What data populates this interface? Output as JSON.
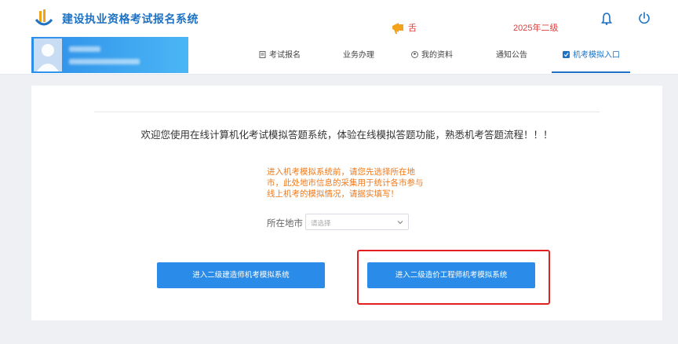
{
  "header": {
    "site_title": "建设执业资格考试报名系统",
    "notice_text": "舌",
    "year_level": "2025年二级"
  },
  "nav": {
    "items": [
      {
        "label": "考试报名",
        "icon": "document-icon"
      },
      {
        "label": "业务办理",
        "icon": ""
      },
      {
        "label": "我的资料",
        "icon": "user-icon"
      },
      {
        "label": "通知公告",
        "icon": ""
      },
      {
        "label": "机考模拟入口",
        "icon": "checkbox-icon",
        "active": true
      }
    ]
  },
  "main": {
    "welcome": "欢迎您使用在线计算机化考试模拟答题系统，体验在线模拟答题功能，熟悉机考答题流程！！！",
    "warning": "进入机考模拟系统前，请您先选择所在地市，此处地市信息的采集用于统计各市参与线上机考的模拟情况，请据实填写！",
    "city_label": "所在地市",
    "city_placeholder": "请选择",
    "button_a": "进入二级建造师机考模拟系统",
    "button_b": "进入二级造价工程师机考模拟系统"
  },
  "colors": {
    "brand": "#1d72c4",
    "button": "#2a8ce8",
    "warning": "#f07a1a",
    "highlight": "#e22020"
  }
}
